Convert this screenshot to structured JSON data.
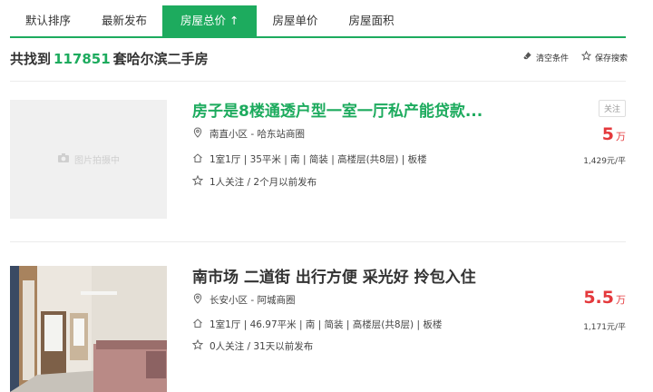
{
  "tabs": [
    {
      "label": "默认排序"
    },
    {
      "label": "最新发布"
    },
    {
      "label": "房屋总价 ↑",
      "active": true
    },
    {
      "label": "房屋单价"
    },
    {
      "label": "房屋面积"
    }
  ],
  "summary": {
    "prefix": "共找到",
    "count": "117851",
    "suffix": "套哈尔滨二手房"
  },
  "actions": {
    "clear": "清空条件",
    "save": "保存搜索"
  },
  "listings": [
    {
      "title": "房子是8楼通透户型一室一厅私产能贷款...",
      "location": "南直小区 - 哈东站商圈",
      "info": "1室1厅 | 35平米 | 南 | 简装 | 高楼层(共8层) | 板楼",
      "follow": "1人关注 / 2个月以前发布",
      "price": "5",
      "price_unit": "万",
      "unit_price": "1,429元/平",
      "follow_button": "关注",
      "thumb_placeholder": "图片拍摄中"
    },
    {
      "title": "南市场 二道街 出行方便 采光好 拎包入住",
      "location": "长安小区 - 阿城商圈",
      "info": "1室1厅 | 46.97平米 | 南 | 简装 | 高楼层(共8层) | 板楼",
      "follow": "0人关注 / 31天以前发布",
      "price": "5.5",
      "price_unit": "万",
      "unit_price": "1,171元/平"
    }
  ],
  "colors": {
    "accent": "#1dab5e",
    "price": "#e4393c"
  }
}
